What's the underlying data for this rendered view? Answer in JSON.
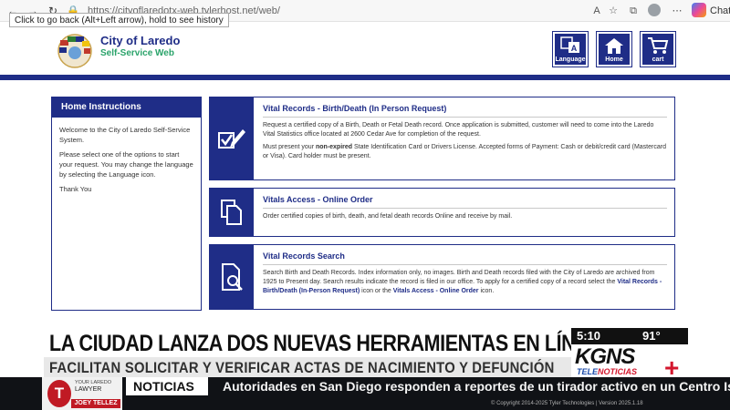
{
  "browser": {
    "url": "https://cityoflaredotx-web.tylerhost.net/web/",
    "tooltip": "Click to go back (Alt+Left arrow), hold to see history",
    "chat_label": "Chat"
  },
  "header": {
    "title": "City of Laredo",
    "subtitle": "Self-Service Web",
    "buttons": {
      "language": "Language",
      "home": "Home",
      "cart": "cart"
    }
  },
  "instructions": {
    "heading": "Home Instructions",
    "paragraphs": [
      "Welcome to the City of Laredo Self-Service System.",
      "Please select one of the options to start your request. You may change the language by selecting the Language icon.",
      "Thank You"
    ]
  },
  "cards": [
    {
      "title": "Vital Records - Birth/Death (In Person Request)",
      "p1": "Request a certified copy of a Birth, Death or Fetal Death record. Once application is submitted, customer will need to come into the Laredo Vital Statistics office located at 2600 Cedar Ave for completion of the request.",
      "p2_before": "Must present your ",
      "p2_bold": "non-expired",
      "p2_after": " State Identification Card or Drivers License.  Accepted forms of Payment: Cash or debit/credit card (Mastercard or Visa). Card holder must be present."
    },
    {
      "title": "Vitals Access - Online Order",
      "p1": "Order certified copies of birth, death, and fetal death records Online and receive by mail."
    },
    {
      "title": "Vital Records Search",
      "p1": "Search Birth and Death Records. Index information only, no images. Birth and Death records filed with the City of Laredo are archived from 1925 to Present day. Search results indicate the record is filed in our office. To apply for a certified copy of a record select the ",
      "link1": "Vital Records - Birth/Death (In-Person Request)",
      "mid": " icon or the ",
      "link2": "Vitals Access - Online Order",
      "end": " icon."
    }
  ],
  "news": {
    "headline": "LA CIUDAD LANZA DOS NUEVAS HERRAMIENTAS EN LÍNEA",
    "subheadline": "FACILITAN SOLICITAR Y VERIFICAR ACTAS DE NACIMIENTO Y DEFUNCIÓN",
    "time": "5:10",
    "temp": "91°",
    "station": "KGNS",
    "network_a": "TELE",
    "network_b": "NOTICIAS",
    "section": "NOTICIAS",
    "ticker": "Autoridades en San Diego responden a reportes de un tirador activo en un Centro Is",
    "ad_line1": "YOUR LAREDO",
    "ad_line2": "LAWYER",
    "ad_name": "JOEY TELLEZ",
    "copyright": "© Copyright 2014-2025 Tyler Technologies | Version 2025.1.18"
  }
}
